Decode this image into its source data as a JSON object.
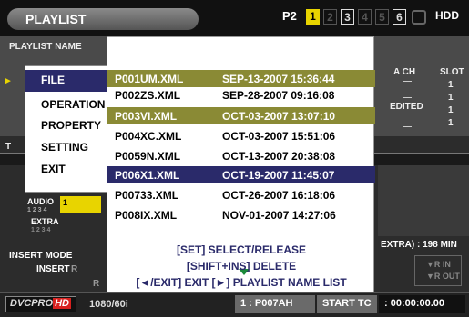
{
  "header": {
    "title": "PLAYLIST",
    "card_label": "P2",
    "slots": [
      "1",
      "2",
      "3",
      "4",
      "5",
      "6"
    ],
    "hdd_label": "HDD"
  },
  "background": {
    "playlist_name_header": "PLAYLIST NAME",
    "col_a_ch": "A CH",
    "col_slot": "SLOT",
    "row_values": [
      "1",
      "1",
      "1",
      "1"
    ],
    "edited_label": "EDITED",
    "track_t_label": "T",
    "audio_label": "AUDIO",
    "audio_channels": "1 2 3 4",
    "audio_bar_value": "1",
    "extra_label": "EXTRA",
    "extra_channels": "1 2 3 4",
    "insert_mode_label": "INSERT MODE",
    "insert_value": "INSERT",
    "extra_remaining": "EXTRA) : 198 MIN",
    "r_in_label": "R IN",
    "r_out_label": "R OUT",
    "r_hint": "R"
  },
  "menu": {
    "items": [
      {
        "label": "FILE",
        "selected": true
      },
      {
        "label": "OPERATION",
        "selected": false
      },
      {
        "label": "PROPERTY",
        "selected": false
      },
      {
        "label": "SETTING",
        "selected": false
      },
      {
        "label": "EXIT",
        "selected": false
      }
    ]
  },
  "file_list": {
    "files": [
      {
        "name": "P001UM.XML",
        "date": "SEP-13-2007 15:36:44",
        "state": "marked"
      },
      {
        "name": "P002ZS.XML",
        "date": "SEP-28-2007 09:16:08",
        "state": "normal"
      },
      {
        "name": "P003VI.XML",
        "date": "OCT-03-2007 13:07:10",
        "state": "marked"
      },
      {
        "name": "P004XC.XML",
        "date": "OCT-03-2007 15:51:06",
        "state": "normal"
      },
      {
        "name": "P0059N.XML",
        "date": "OCT-13-2007 20:38:08",
        "state": "normal"
      },
      {
        "name": "P006X1.XML",
        "date": "OCT-19-2007 11:45:07",
        "state": "selected"
      },
      {
        "name": "P00733.XML",
        "date": "OCT-26-2007 16:18:06",
        "state": "normal"
      },
      {
        "name": "P008IX.XML",
        "date": "NOV-01-2007 14:27:06",
        "state": "normal"
      }
    ],
    "help_lines": [
      "[SET] SELECT/RELEASE",
      "[SHIFT+INS] DELETE",
      "[◄/EXIT] EXIT  [►] PLAYLIST NAME LIST"
    ]
  },
  "status": {
    "codec_prefix": "DVCPRO",
    "codec_hd": "HD",
    "format": "1080/60i",
    "clip": "1 : P007AH",
    "start_tc_label": "START TC",
    "timecode": ": 00:00:00.00"
  },
  "colors": {
    "selected_row": "#2a2a6a",
    "marked_row": "#8a8a35",
    "slot_active": "#e8d400",
    "hd_badge": "#d8201e",
    "help_text": "#2a2a6a"
  }
}
